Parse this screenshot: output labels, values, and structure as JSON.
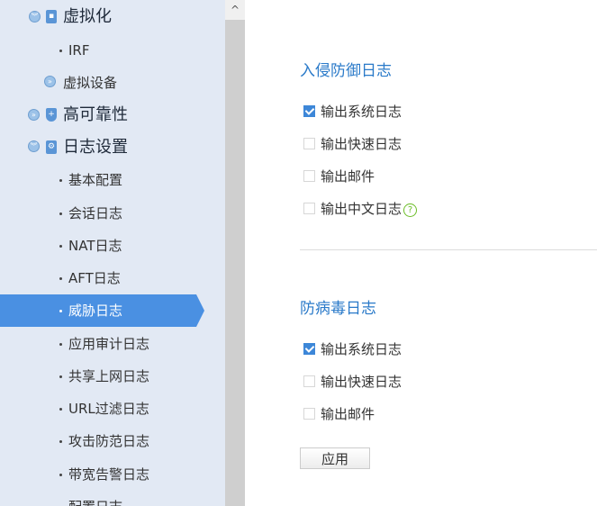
{
  "sidebar": {
    "items": [
      {
        "label": "虚拟化"
      },
      {
        "label": "IRF"
      },
      {
        "label": "虚拟设备"
      },
      {
        "label": "高可靠性"
      },
      {
        "label": "日志设置"
      },
      {
        "label": "基本配置"
      },
      {
        "label": "会话日志"
      },
      {
        "label": "NAT日志"
      },
      {
        "label": "AFT日志"
      },
      {
        "label": "威胁日志"
      },
      {
        "label": "应用审计日志"
      },
      {
        "label": "共享上网日志"
      },
      {
        "label": "URL过滤日志"
      },
      {
        "label": "攻击防范日志"
      },
      {
        "label": "带宽告警日志"
      },
      {
        "label": "配置日志"
      }
    ],
    "active_label": "威胁日志"
  },
  "scrollbar": {
    "up_glyph": "^"
  },
  "ips": {
    "title": "入侵防御日志",
    "options": [
      {
        "label": "输出系统日志",
        "checked": true
      },
      {
        "label": "输出快速日志",
        "checked": false
      },
      {
        "label": "输出邮件",
        "checked": false
      },
      {
        "label": "输出中文日志",
        "checked": false
      }
    ],
    "help_glyph": "?"
  },
  "av": {
    "title": "防病毒日志",
    "options": [
      {
        "label": "输出系统日志",
        "checked": true
      },
      {
        "label": "输出快速日志",
        "checked": false
      },
      {
        "label": "输出邮件",
        "checked": false
      }
    ]
  },
  "apply_label": "应用",
  "colors": {
    "sidebar_bg": "#e2e9f4",
    "active_bg": "#4a90e2",
    "title_blue": "#2a7ac9",
    "checkbox_blue": "#3d87d8",
    "help_green": "#6bbd27"
  }
}
